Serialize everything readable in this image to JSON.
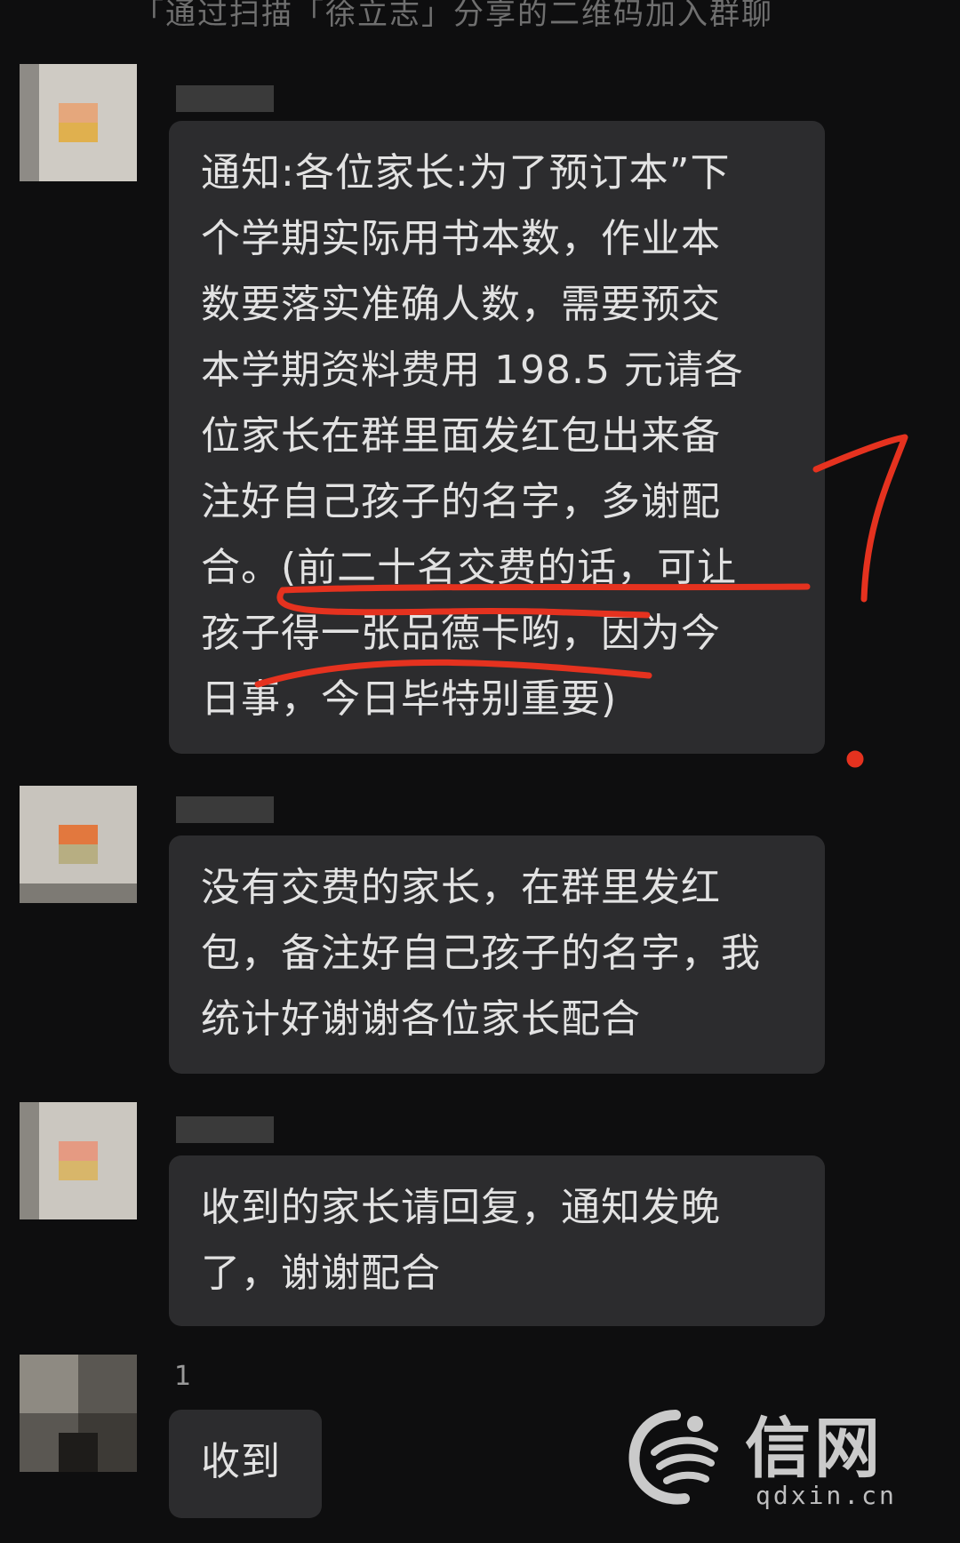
{
  "system_notice": "「通过扫描「徐立志」分享的二维码加入群聊",
  "messages": [
    {
      "lines": [
        "通知:各位家长:为了预订本”下",
        "个学期实际用书本数，作业本",
        "数要落实准确人数，需要预交",
        "本学期资料费用 198.5 元请各",
        "位家长在群里面发红包出来备",
        "注好自己孩子的名字，多谢配",
        "合。(前二十名交费的话，可让",
        "孩子得一张品德卡哟，因为今",
        "日事，今日毕特别重要)"
      ]
    },
    {
      "lines": [
        "没有交费的家长，在群里发红",
        "包，备注好自己孩子的名字，我",
        "统计好谢谢各位家长配合"
      ]
    },
    {
      "lines": [
        "收到的家长请回复，通知发晚",
        "了，谢谢配合"
      ]
    },
    {
      "nickname": "1",
      "lines": [
        "收到"
      ]
    }
  ],
  "annotation_color": "#e5321f",
  "watermark": {
    "name": "信网",
    "domain": "qdxin.cn"
  }
}
